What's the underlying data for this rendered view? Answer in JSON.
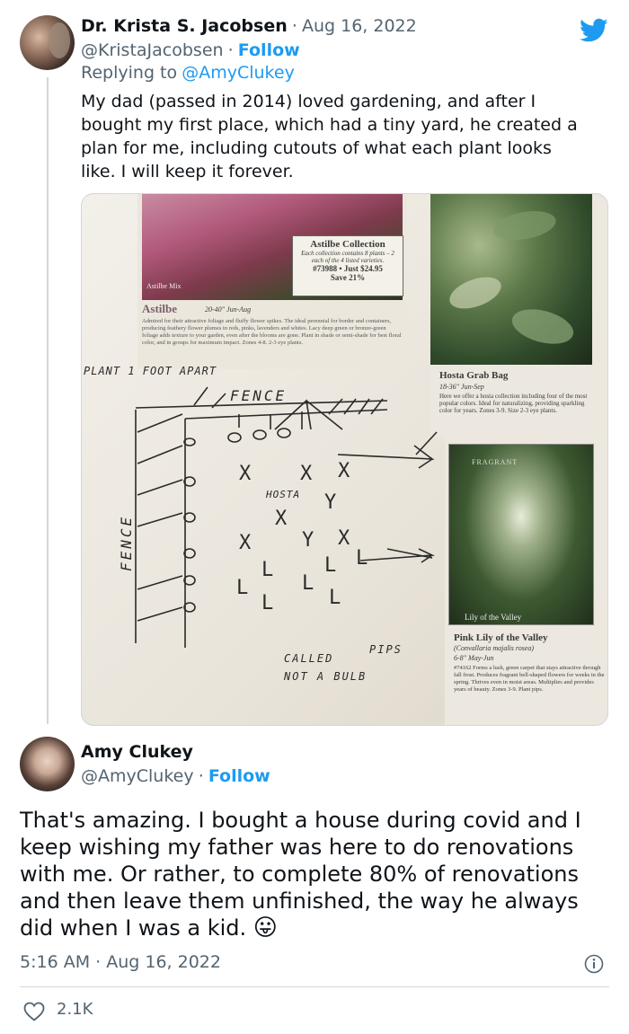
{
  "reply_tweet": {
    "author_name": "Dr. Krista S. Jacobsen",
    "date": "Aug 16, 2022",
    "handle": "@KristaJacobsen",
    "follow_label": "Follow",
    "replying_to_prefix": "Replying to",
    "replying_to_handle": "@AmyClukey",
    "text": "My dad (passed in 2014) loved gardening, and after I bought my first place, which had a tiny yard, he created a plan for me, including cutouts of what each plant looks like. I will keep it forever."
  },
  "photo": {
    "astilbe": {
      "box_title": "Astilbe Collection",
      "box_desc": "Each collection contains 8 plants – 2 each of the 4 listed varieties.",
      "box_price": "#73988 • Just $24.95",
      "box_save": "Save 21%",
      "mix_label": "Astilbe Mix",
      "heading": "Astilbe",
      "meta": "20-40\" Jun-Aug",
      "desc": "Admired for their attractive foliage and fluffy flower spikes. The ideal perennial for border and containers, producing feathery flower plumes in reds, pinks, lavenders and whites. Lacy deep green or bronze-green foliage adds texture to your garden, even after the blooms are gone. Plant in shade or semi-shade for best floral color, and in groups for maximum impact. Zones 4-8. 2-3 eye plants."
    },
    "hosta": {
      "title": "Hosta Grab Bag",
      "meta": "18-36\" Jun-Sep",
      "desc": "Here we offer a hosta collection including four of the most popular colors. Ideal for naturalizing, providing sparkling color for years. Zones 3-9. Size 2-3 eye plants."
    },
    "lily": {
      "fragrant_label": "FRAGRANT",
      "photo_label": "Lily of the Valley",
      "title": "Pink Lily of the Valley",
      "latin": "(Convallaria majalis rosea)",
      "meta": "6-8\" May-Jun",
      "desc": "#74162  Forms a lush, green carpet that stays attractive through fall frost. Produces fragrant bell-shaped flowers for weeks in the spring. Thrives even in moist areas. Multiplies and provides years of beauty. Zones 3-9. Plant pips."
    },
    "handwriting": {
      "plant_note": "PLANT 1 FOOT APART",
      "fence_top": "FENCE",
      "fence_side": "FENCE",
      "hosta": "HOSTA",
      "called": "CALLED",
      "pips": "PIPS",
      "not_bulb": "NOT A BULB"
    }
  },
  "main_tweet": {
    "author_name": "Amy Clukey",
    "handle": "@AmyClukey",
    "follow_label": "Follow",
    "text": "That's amazing. I bought a house during covid and I keep wishing my father was here to do renovations with me. Or rather, to complete 80% of renovations and then leave them unfinished, the way he always did when I was a kid.",
    "emoji": "😛",
    "timestamp": "5:16 AM · Aug 16, 2022",
    "like_count": "2.1K"
  },
  "icons": {
    "bird": "twitter-bird-icon",
    "info": "info-icon",
    "heart": "heart-icon"
  },
  "colors": {
    "accent": "#1d9bf0",
    "text": "#0f1419",
    "muted": "#536471",
    "divider": "#cfd9de"
  }
}
